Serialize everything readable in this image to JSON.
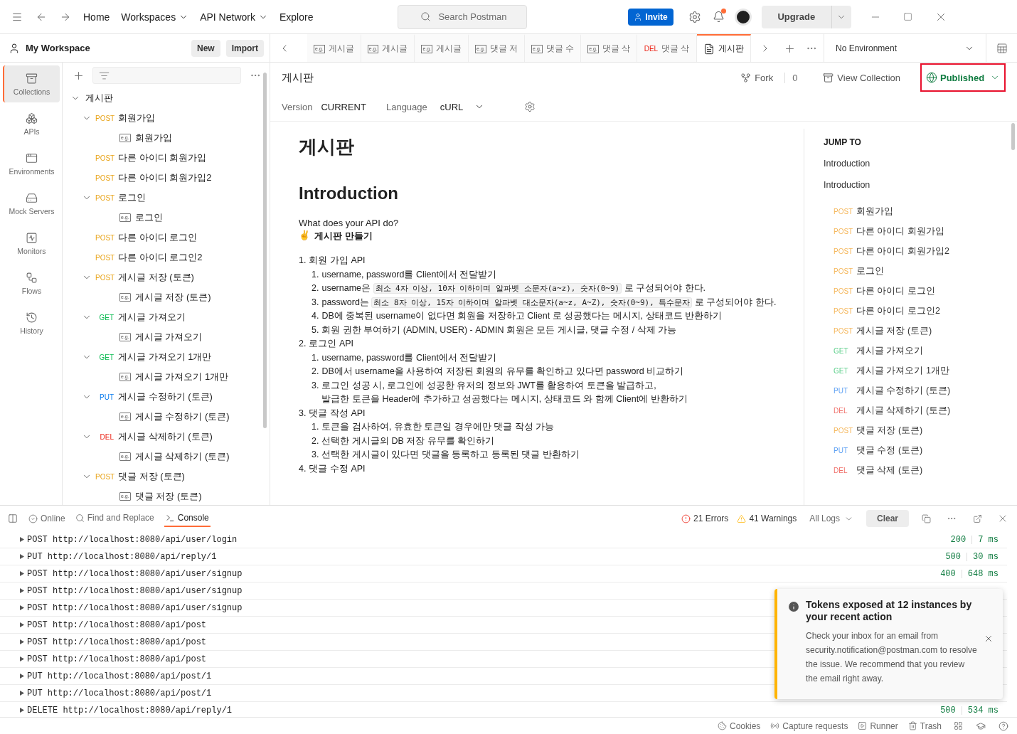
{
  "topbar": {
    "nav": [
      {
        "label": "Home",
        "dropdown": false
      },
      {
        "label": "Workspaces",
        "dropdown": true
      },
      {
        "label": "API Network",
        "dropdown": true
      },
      {
        "label": "Explore",
        "dropdown": false
      }
    ],
    "search": {
      "placeholder": "Search Postman"
    },
    "invite": "Invite",
    "notification_dot": true,
    "upgrade": "Upgrade"
  },
  "workspace": {
    "name": "My Workspace",
    "buttons": [
      "New",
      "Import"
    ]
  },
  "rail": [
    {
      "label": "Collections",
      "selected": true
    },
    {
      "label": "APIs",
      "selected": false
    },
    {
      "label": "Environments",
      "selected": false
    },
    {
      "label": "Mock Servers",
      "selected": false
    },
    {
      "label": "Monitors",
      "selected": false
    },
    {
      "label": "Flows",
      "selected": false
    },
    {
      "label": "History",
      "selected": false
    }
  ],
  "tree": {
    "name": "게시판",
    "expanded": true,
    "children": [
      {
        "method": "POST",
        "color": "#e8a317",
        "name": "회원가입",
        "expanded": true,
        "children": [
          {
            "badge": "e.g.",
            "name": "회원가입"
          }
        ]
      },
      {
        "method": "POST",
        "color": "#e8a317",
        "name": "다른 아이디 회원가입"
      },
      {
        "method": "POST",
        "color": "#e8a317",
        "name": "다른 아이디 회원가입2"
      },
      {
        "method": "POST",
        "color": "#e8a317",
        "name": "로그인",
        "expanded": true,
        "children": [
          {
            "badge": "e.g.",
            "name": "로그인"
          }
        ]
      },
      {
        "method": "POST",
        "color": "#e8a317",
        "name": "다른 아이디 로그인"
      },
      {
        "method": "POST",
        "color": "#e8a317",
        "name": "다른 아이디 로그인2"
      },
      {
        "method": "POST",
        "color": "#e8a317",
        "name": "게시글 저장 (토큰)",
        "expanded": true,
        "children": [
          {
            "badge": "e.g.",
            "name": "게시글 저장 (토큰)"
          }
        ]
      },
      {
        "method": "GET",
        "color": "#0cbb52",
        "name": "게시글 가져오기",
        "expanded": true,
        "children": [
          {
            "badge": "e.g.",
            "name": "게시글 가져오기"
          }
        ]
      },
      {
        "method": "GET",
        "color": "#0cbb52",
        "name": "게시글 가져오기 1개만",
        "expanded": true,
        "children": [
          {
            "badge": "e.g.",
            "name": "게시글 가져오기 1개만"
          }
        ]
      },
      {
        "method": "PUT",
        "color": "#097bed",
        "name": "게시글 수정하기 (토큰)",
        "expanded": true,
        "children": [
          {
            "badge": "e.g.",
            "name": "게시글 수정하기 (토큰)"
          }
        ]
      },
      {
        "method": "DEL",
        "color": "#eb2013",
        "name": "게시글 삭제하기 (토큰)",
        "expanded": true,
        "children": [
          {
            "badge": "e.g.",
            "name": "게시글 삭제하기 (토큰)"
          }
        ]
      },
      {
        "method": "POST",
        "color": "#e8a317",
        "name": "댓글 저장 (토큰)",
        "expanded": true,
        "children": [
          {
            "badge": "e.g.",
            "name": "댓글 저장 (토큰)"
          }
        ]
      }
    ]
  },
  "tabs": [
    {
      "kind": "example",
      "badge": "e.g.",
      "label": "게시글",
      "selected": false
    },
    {
      "kind": "example",
      "badge": "e.g.",
      "label": "게시글",
      "selected": false
    },
    {
      "kind": "example",
      "badge": "e.g.",
      "label": "게시글",
      "selected": false
    },
    {
      "kind": "example",
      "badge": "e.g.",
      "label": "댓글 저",
      "selected": false
    },
    {
      "kind": "example",
      "badge": "e.g.",
      "label": "댓글 수",
      "selected": false
    },
    {
      "kind": "example",
      "badge": "e.g.",
      "label": "댓글 삭",
      "selected": false
    },
    {
      "kind": "request",
      "method": "DEL",
      "color": "#eb2013",
      "label": "댓글 삭",
      "selected": false
    },
    {
      "kind": "doc",
      "label": "게시판",
      "selected": true
    }
  ],
  "environment": "No Environment",
  "doc_header": {
    "title": "게시판",
    "fork": "Fork",
    "fork_count": "0",
    "view": "View Collection",
    "published": "Published"
  },
  "options": {
    "version_label": "Version",
    "version": "CURRENT",
    "language_label": "Language",
    "language": "cURL"
  },
  "doc": {
    "title": "게시판",
    "section": "Introduction",
    "question": "What does your API do?",
    "emoji": "✌",
    "tagline": "게시판 만들기",
    "list": [
      {
        "number": "1.",
        "text": "회원 가입 API",
        "children": [
          {
            "number": "1.",
            "segments": [
              {
                "kind": "text",
                "text": "username, password를 Client에서 전달받기"
              }
            ]
          },
          {
            "number": "2.",
            "segments": [
              {
                "kind": "text",
                "text": "username은 "
              },
              {
                "kind": "code",
                "text": "최소 4자 이상, 10자 이하이며 알파벳 소문자(a~z), 숫자(0~9)"
              },
              {
                "kind": "text",
                "text": " 로 구성되어야 한다."
              }
            ]
          },
          {
            "number": "3.",
            "segments": [
              {
                "kind": "text",
                "text": "password는 "
              },
              {
                "kind": "code",
                "text": "최소 8자 이상, 15자 이하이며 알파벳 대소문자(a~z, A~Z), 숫자(0~9), 특수문자"
              },
              {
                "kind": "text",
                "text": " 로 구성되어야 한다."
              }
            ]
          },
          {
            "number": "4.",
            "segments": [
              {
                "kind": "text",
                "text": "DB에 중복된 username이 없다면 회원을 저장하고 Client 로 성공했다는 메시지, 상태코드 반환하기"
              }
            ]
          },
          {
            "number": "5.",
            "segments": [
              {
                "kind": "text",
                "text": "회원 권한 부여하기 (ADMIN, USER) - ADMIN 회원은 모든 게시글, 댓글 수정 / 삭제 가능"
              }
            ]
          }
        ]
      },
      {
        "number": "2.",
        "text": "로그인 API",
        "children": [
          {
            "number": "1.",
            "segments": [
              {
                "kind": "text",
                "text": "username, password를 Client에서 전달받기"
              }
            ]
          },
          {
            "number": "2.",
            "segments": [
              {
                "kind": "text",
                "text": "DB에서 username을 사용하여 저장된 회원의 유무를 확인하고 있다면 password 비교하기"
              }
            ]
          },
          {
            "number": "3.",
            "segments": [
              {
                "kind": "text",
                "text": "로그인 성공 시, 로그인에 성공한 유저의 정보와 JWT를 활용하여 토큰을 발급하고,"
              },
              {
                "kind": "break",
                "text": "발급한 토큰을 Header에 추가하고 성공했다는 메시지, 상태코드 와 함께 Client에 반환하기"
              }
            ]
          }
        ]
      },
      {
        "number": "3.",
        "text": "댓글 작성 API",
        "children": [
          {
            "number": "1.",
            "segments": [
              {
                "kind": "text",
                "text": "토큰을 검사하여, 유효한 토큰일 경우에만 댓글 작성 가능"
              }
            ]
          },
          {
            "number": "2.",
            "segments": [
              {
                "kind": "text",
                "text": "선택한 게시글의 DB 저장 유무를 확인하기"
              }
            ]
          },
          {
            "number": "3.",
            "segments": [
              {
                "kind": "text",
                "text": "선택한 게시글이 있다면 댓글을 등록하고 등록된 댓글 반환하기"
              }
            ]
          }
        ]
      },
      {
        "number": "4.",
        "text": "댓글 수정 API"
      }
    ]
  },
  "jump": {
    "heading": "JUMP TO",
    "links": [
      "Introduction",
      "Introduction"
    ],
    "items": [
      {
        "method": "POST",
        "color": "#f5b75c",
        "name": "회원가입"
      },
      {
        "method": "POST",
        "color": "#f5b75c",
        "name": "다른 아이디 회원가입"
      },
      {
        "method": "POST",
        "color": "#f5b75c",
        "name": "다른 아이디 회원가입2"
      },
      {
        "method": "POST",
        "color": "#f5b75c",
        "name": "로그인"
      },
      {
        "method": "POST",
        "color": "#f5b75c",
        "name": "다른 아이디 로그인"
      },
      {
        "method": "POST",
        "color": "#f5b75c",
        "name": "다른 아이디 로그인2"
      },
      {
        "method": "POST",
        "color": "#f5b75c",
        "name": "게시글 저장 (토큰)"
      },
      {
        "method": "GET",
        "color": "#5ccf8a",
        "name": "게시글 가져오기"
      },
      {
        "method": "GET",
        "color": "#5ccf8a",
        "name": "게시글 가져오기 1개만"
      },
      {
        "method": "PUT",
        "color": "#5b9ff3",
        "name": "게시글 수정하기 (토큰)"
      },
      {
        "method": "DEL",
        "color": "#f0706a",
        "name": "게시글 삭제하기 (토큰)"
      },
      {
        "method": "POST",
        "color": "#f5b75c",
        "name": "댓글 저장 (토큰)"
      },
      {
        "method": "PUT",
        "color": "#5b9ff3",
        "name": "댓글 수정 (토큰)"
      },
      {
        "method": "DEL",
        "color": "#f0706a",
        "name": "댓글 삭제 (토큰)"
      }
    ]
  },
  "console": {
    "online": "Online",
    "tabs": [
      {
        "label": "Find and Replace",
        "selected": false
      },
      {
        "label": "Console",
        "selected": true
      }
    ],
    "errors": "21 Errors",
    "warnings": "41 Warnings",
    "filter": "All Logs",
    "clear": "Clear",
    "rows": [
      {
        "request": "POST http://localhost:8080/api/user/login",
        "status": "200",
        "time": "7 ms"
      },
      {
        "request": "PUT http://localhost:8080/api/reply/1",
        "status": "500",
        "time": "30 ms"
      },
      {
        "request": "POST http://localhost:8080/api/user/signup",
        "status": "400",
        "time": "648 ms"
      },
      {
        "request": "POST http://localhost:8080/api/user/signup"
      },
      {
        "request": "POST http://localhost:8080/api/user/signup"
      },
      {
        "request": "POST http://localhost:8080/api/post"
      },
      {
        "request": "POST http://localhost:8080/api/post"
      },
      {
        "request": "POST http://localhost:8080/api/post"
      },
      {
        "request": "PUT http://localhost:8080/api/post/1"
      },
      {
        "request": "PUT http://localhost:8080/api/post/1"
      },
      {
        "request": "DELETE http://localhost:8080/api/reply/1",
        "status": "500",
        "time": "534 ms"
      }
    ]
  },
  "toast": {
    "title": "Tokens exposed at 12 instances by your recent action",
    "body": "Check your inbox for an email from security.notification@postman.com to resolve the issue. We recommend that you review the email right away."
  },
  "statusbar": [
    "Cookies",
    "Capture requests",
    "Runner",
    "Trash"
  ]
}
